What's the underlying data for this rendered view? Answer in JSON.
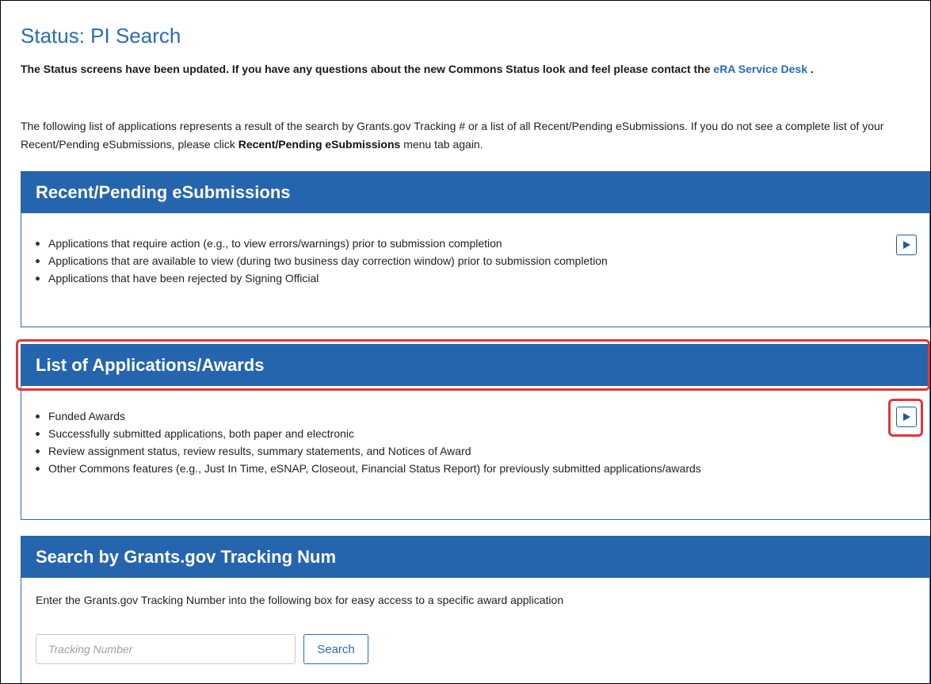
{
  "page": {
    "title": "Status: PI Search",
    "notice_text": "The Status screens have been updated. If you have any questions about the new Commons Status look and feel please contact the ",
    "notice_link": "eRA Service Desk",
    "notice_end": " .",
    "intro_text_1": "The following list of applications represents a result of the search by Grants.gov Tracking # or a list of all Recent/Pending eSubmissions. If you do not see a complete list of your Recent/Pending eSubmissions, please click ",
    "intro_bold": "Recent/Pending eSubmissions",
    "intro_text_2": " menu tab again."
  },
  "recent_panel": {
    "title": "Recent/Pending eSubmissions",
    "items": [
      "Applications that require action (e.g., to view errors/warnings) prior to submission completion",
      "Applications that are available to view (during two business day correction window) prior to submission completion",
      "Applications that have been rejected by Signing Official"
    ],
    "button_icon": "play-icon"
  },
  "list_panel": {
    "title": "List of Applications/Awards",
    "items": [
      "Funded Awards",
      "Successfully submitted applications, both paper and electronic",
      "Review assignment status, review results, summary statements, and Notices of Award",
      "Other Commons features (e.g., Just In Time, eSNAP, Closeout, Financial Status Report) for previously submitted applications/awards"
    ],
    "button_icon": "play-icon",
    "highlight_color": "#e0373b"
  },
  "search_panel": {
    "title": "Search by Grants.gov Tracking Num",
    "description": "Enter the Grants.gov Tracking Number into the following box for easy access to a specific award application",
    "input_placeholder": "Tracking Number",
    "input_value": "",
    "button_label": "Search"
  },
  "colors": {
    "header_blue": "#2565ae",
    "title_blue": "#2a6bb5",
    "highlight_red": "#e0373b"
  }
}
